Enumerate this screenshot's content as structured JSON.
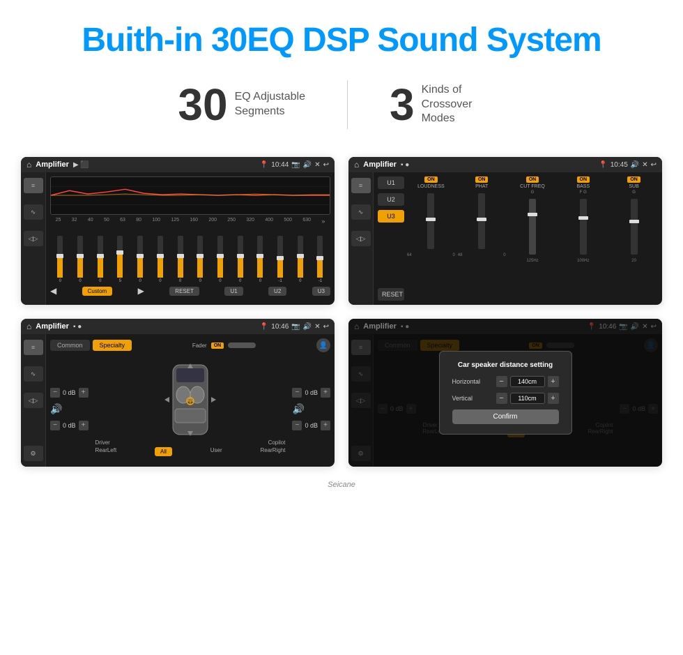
{
  "page": {
    "title": "Buith-in 30EQ DSP Sound System",
    "stat1_num": "30",
    "stat1_label": "EQ Adjustable\nSegments",
    "stat2_num": "3",
    "stat2_label": "Kinds of\nCrossover Modes"
  },
  "screen1": {
    "topbar": {
      "app": "Amplifier",
      "time": "10:44"
    },
    "eq_freqs": [
      "25",
      "32",
      "40",
      "50",
      "63",
      "80",
      "100",
      "125",
      "160",
      "200",
      "250",
      "320",
      "400",
      "500",
      "630"
    ],
    "eq_vals": [
      "0",
      "0",
      "0",
      "0",
      "5",
      "0",
      "0",
      "0",
      "0",
      "0",
      "0",
      "0",
      "-1",
      "0",
      "-1"
    ],
    "preset": "Custom",
    "buttons": [
      "RESET",
      "U1",
      "U2",
      "U3"
    ]
  },
  "screen2": {
    "topbar": {
      "app": "Amplifier",
      "time": "10:45"
    },
    "presets": [
      "U1",
      "U2",
      "U3"
    ],
    "active_preset": "U3",
    "channels": [
      {
        "name": "LOUDNESS",
        "on": true
      },
      {
        "name": "PHAT",
        "on": true
      },
      {
        "name": "CUT FREQ",
        "on": true
      },
      {
        "name": "BASS",
        "on": true
      },
      {
        "name": "SUB",
        "on": true
      }
    ],
    "reset_btn": "RESET"
  },
  "screen3": {
    "topbar": {
      "app": "Amplifier",
      "time": "10:46"
    },
    "tabs": [
      "Common",
      "Specialty"
    ],
    "active_tab": "Specialty",
    "fader_label": "Fader",
    "fader_on": "ON",
    "db_rows": [
      {
        "label": "0 dB"
      },
      {
        "label": "0 dB"
      },
      {
        "label": "0 dB"
      },
      {
        "label": "0 dB"
      }
    ],
    "bottom_labels": [
      "Driver",
      "",
      "",
      "",
      "Copilot"
    ],
    "bottom_labels2": [
      "RearLeft",
      "All",
      "User",
      "RearRight"
    ]
  },
  "screen4": {
    "topbar": {
      "app": "Amplifier",
      "time": "10:46"
    },
    "tabs": [
      "Common",
      "Specialty"
    ],
    "active_tab": "Specialty",
    "modal": {
      "title": "Car speaker distance setting",
      "h_label": "Horizontal",
      "h_value": "140cm",
      "v_label": "Vertical",
      "v_value": "110cm",
      "confirm": "Confirm"
    },
    "bottom_labels": [
      "Driver",
      "",
      "",
      "",
      "Copilot"
    ],
    "bottom_labels2": [
      "RearLeft",
      "All",
      "User",
      "RearRight"
    ]
  },
  "watermark": "Seicane"
}
